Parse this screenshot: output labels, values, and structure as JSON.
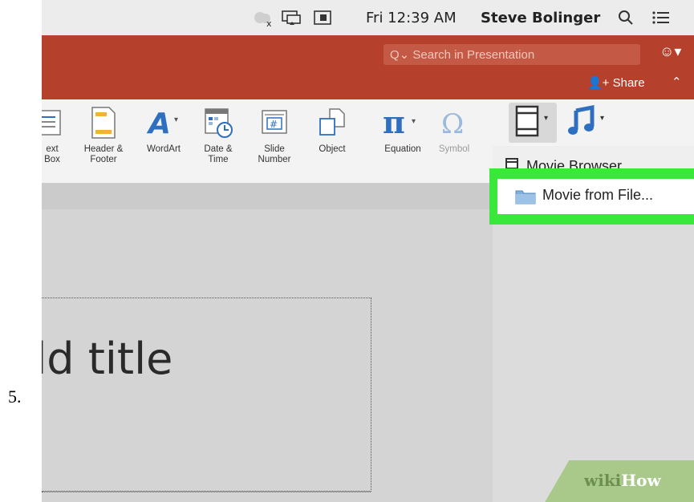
{
  "step_number": "5.",
  "menubar": {
    "clock": "Fri 12:39 AM",
    "user": "Steve Bolinger"
  },
  "titlebar": {
    "search_placeholder": "Q⌄ Search in Presentation",
    "share_label": "Share"
  },
  "ribbon": {
    "items": [
      {
        "label": "ext\nBox",
        "name": "text-box"
      },
      {
        "label": "Header &\nFooter",
        "name": "header-footer"
      },
      {
        "label": "WordArt",
        "name": "wordart"
      },
      {
        "label": "Date &\nTime",
        "name": "date-time"
      },
      {
        "label": "Slide\nNumber",
        "name": "slide-number"
      },
      {
        "label": "Object",
        "name": "object"
      },
      {
        "label": "Equation",
        "name": "equation"
      },
      {
        "label": "Symbol",
        "name": "symbol"
      }
    ],
    "colors": {
      "accent": "#2f6fbf",
      "titlebar": "#b5402b",
      "highlight": "#39e83a"
    }
  },
  "dropdown": {
    "item1": "Movie Browser",
    "item2": "Movie from File..."
  },
  "slide": {
    "title_placeholder": "dd title"
  },
  "watermark": {
    "a": "wiki",
    "b": "How"
  }
}
